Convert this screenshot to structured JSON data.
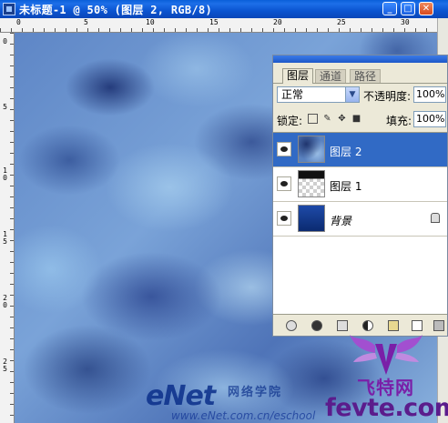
{
  "window": {
    "title": "未标题-1 @ 50% (图层 2, RGB/8)",
    "minimize_glyph": "_",
    "maximize_glyph": "□",
    "close_glyph": "✕",
    "icon": "photoshop-document-icon"
  },
  "rulers": {
    "top_ticks": [
      "0",
      "5",
      "10",
      "15",
      "20",
      "25",
      "30"
    ],
    "left_ticks": [
      "0",
      "5",
      "1\n0",
      "1\n5",
      "2\n0",
      "2\n5"
    ]
  },
  "layers_panel": {
    "tabs": [
      {
        "label": "图层",
        "active": true
      },
      {
        "label": "通道",
        "active": false
      },
      {
        "label": "路径",
        "active": false
      }
    ],
    "blend_mode": "正常",
    "opacity_label": "不透明度:",
    "opacity_value": "100%",
    "lock_label": "锁定:",
    "fill_label": "填充:",
    "fill_value": "100%",
    "layers": [
      {
        "name": "图层 2",
        "selected": true,
        "thumbnail": "clouds"
      },
      {
        "name": "图层 1",
        "selected": false,
        "thumbnail": "transparent-checker"
      },
      {
        "name": "背景",
        "selected": false,
        "thumbnail": "blue-gradient",
        "locked": true
      }
    ],
    "bottom_icons": [
      "link-icon",
      "layer-style-icon",
      "mask-icon",
      "adjustment-layer-icon",
      "new-group-icon",
      "new-layer-icon",
      "trash-icon"
    ]
  },
  "watermarks": {
    "enet_logo": "eNet",
    "enet_cn": "网络学院",
    "enet_url": "www.eNet.com.cn/eschool",
    "fevte_cn": "飞特网",
    "fevte_en": "fevte.com"
  },
  "colors": {
    "titlebar": "#0a5fd9",
    "selected_layer": "#316ac5",
    "panel_bg": "#ece9d8",
    "canvas_base": "#5e86c6"
  }
}
